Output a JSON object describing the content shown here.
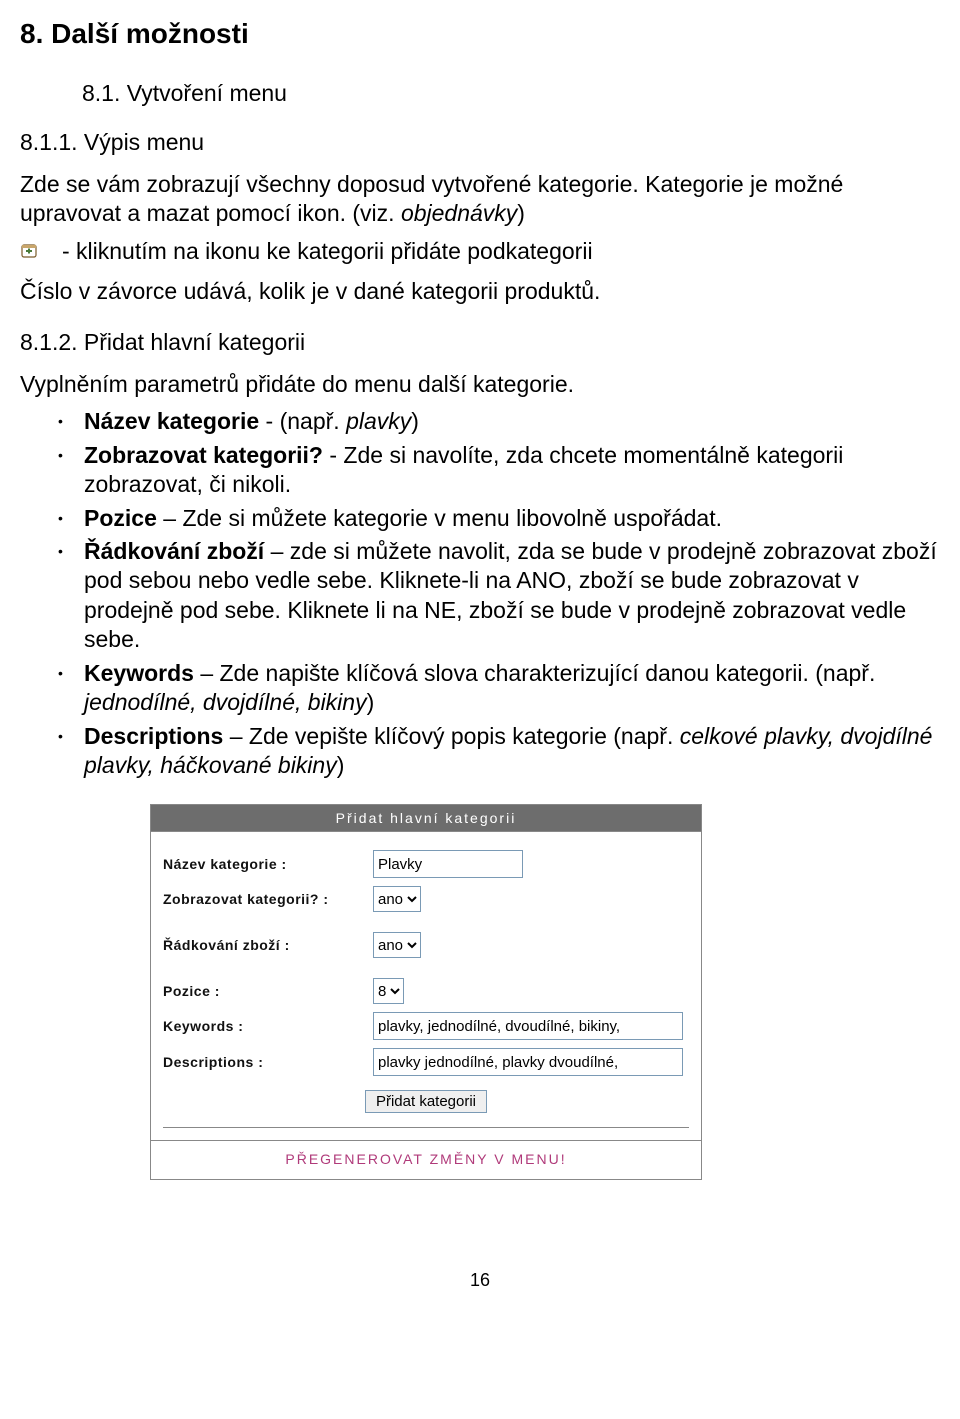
{
  "h1": "8. Další možnosti",
  "h2": "8.1. Vytvoření menu",
  "h3a": "8.1.1. Výpis menu",
  "p1a": "Zde se vám zobrazují všechny doposud vytvořené kategorie. Kategorie je možné upravovat a mazat pomocí ikon. (viz. ",
  "p1b": "objednávky",
  "p1c": ")",
  "icon_line": "- kliknutím na ikonu ke kategorii přidáte podkategorii",
  "p2": "Číslo v závorce udává, kolik je v dané kategorii produktů.",
  "h3b": "8.1.2. Přidat hlavní kategorii",
  "p3": "Vyplněním parametrů přidáte do menu další kategorie.",
  "li1_b": "Název kategorie",
  "li1_a": " - (např. ",
  "li1_i": "plavky",
  "li1_c": ")",
  "li2_b": "Zobrazovat kategorii?",
  "li2_a": " - Zde si navolíte, zda chcete momentálně kategorii zobrazovat, či nikoli.",
  "li3_b": "Pozice",
  "li3_a": " – Zde si můžete kategorie v menu libovolně uspořádat.",
  "li4_b": "Řádkování zboží",
  "li4_a": " – zde si můžete navolit, zda se bude v prodejně zobrazovat zboží pod sebou nebo vedle sebe. Kliknete-li na ANO, zboží se bude zobrazovat v prodejně pod sebe. Kliknete li na NE, zboží se bude v prodejně zobrazovat vedle sebe.",
  "li5_b": "Keywords",
  "li5_a": " – Zde napište klíčová slova charakterizující danou kategorii. (např. ",
  "li5_i": "jednodílné, dvojdílné, bikiny",
  "li5_c": ")",
  "li6_b": "Descriptions",
  "li6_a": " – Zde vepište klíčový popis kategorie (např. ",
  "li6_i": "celkové plavky, dvojdílné plavky, háčkované bikiny",
  "li6_c": ")",
  "form": {
    "title": "Přidat hlavní kategorii",
    "name_label": "Název kategorie :",
    "name_value": "Plavky",
    "show_label": "Zobrazovat kategorii? :",
    "show_value": "ano",
    "row_label": "Řádkování zboží :",
    "row_value": "ano",
    "pos_label": "Pozice :",
    "pos_value": "8",
    "kw_label": "Keywords :",
    "kw_value": "plavky, jednodílné, dvoudílné, bikiny,",
    "desc_label": "Descriptions :",
    "desc_value": "plavky jednodílné, plavky dvoudílné,",
    "submit": "Přidat kategorii",
    "regen": "PŘEGENEROVAT ZMĚNY V MENU!"
  },
  "page_number": "16"
}
